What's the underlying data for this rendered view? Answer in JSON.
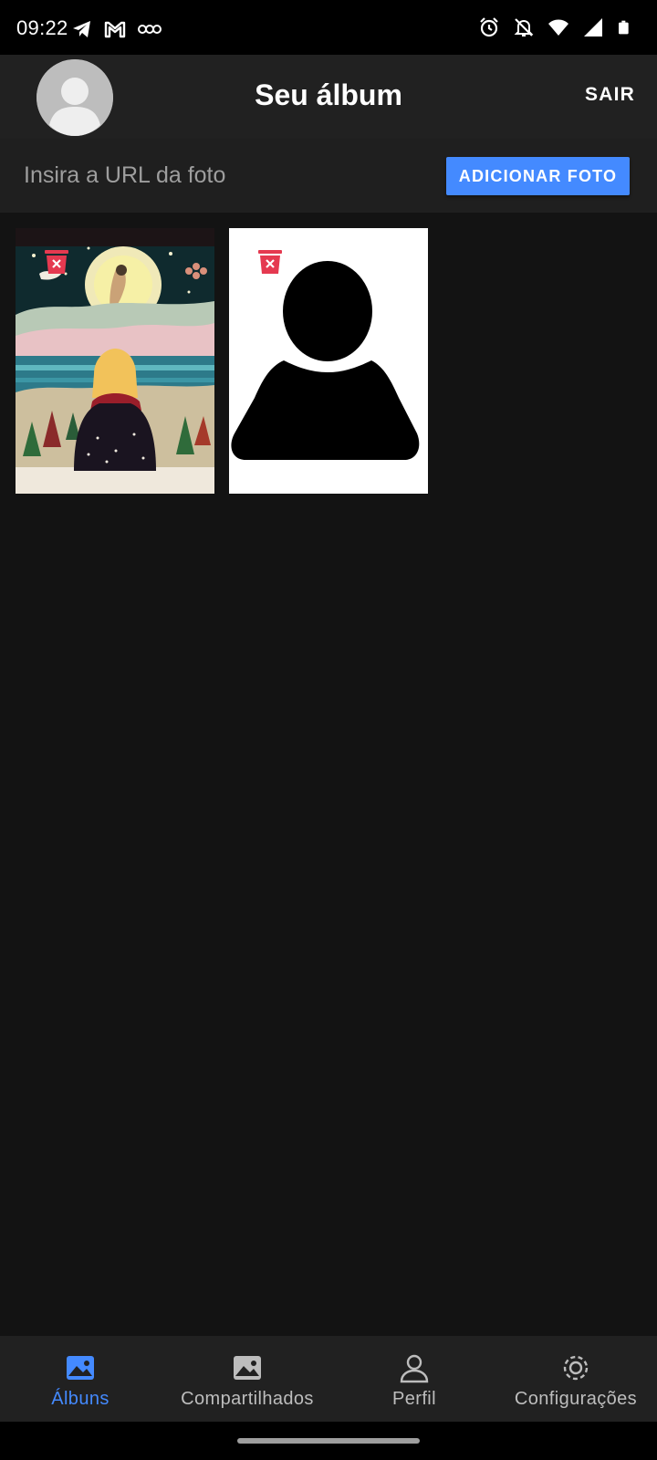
{
  "status_bar": {
    "time": "09:22",
    "left_icons": [
      "telegram-icon",
      "gmail-icon",
      "voicemail-icon"
    ],
    "right_icons": [
      "alarm-icon",
      "notifications-off-icon",
      "wifi-icon",
      "signal-icon",
      "battery-icon"
    ]
  },
  "app_bar": {
    "title": "Seu álbum",
    "logout_label": "SAIR"
  },
  "url_bar": {
    "placeholder": "Insira a URL da foto",
    "value": "",
    "add_button_label": "ADICIONAR FOTO"
  },
  "photos": [
    {
      "kind": "illustration",
      "delete_icon": "trash-icon"
    },
    {
      "kind": "default-avatar-silhouette",
      "delete_icon": "trash-icon"
    }
  ],
  "bottom_nav": {
    "items": [
      {
        "label": "Álbuns",
        "icon": "photo-album-icon",
        "active": true
      },
      {
        "label": "Compartilhados",
        "icon": "shared-photo-icon",
        "active": false
      },
      {
        "label": "Perfil",
        "icon": "person-icon",
        "active": false
      },
      {
        "label": "Configurações",
        "icon": "gear-icon",
        "active": false
      }
    ]
  },
  "colors": {
    "background": "#131313",
    "bar": "#212121",
    "accent": "#448aff",
    "delete": "#e53950"
  }
}
